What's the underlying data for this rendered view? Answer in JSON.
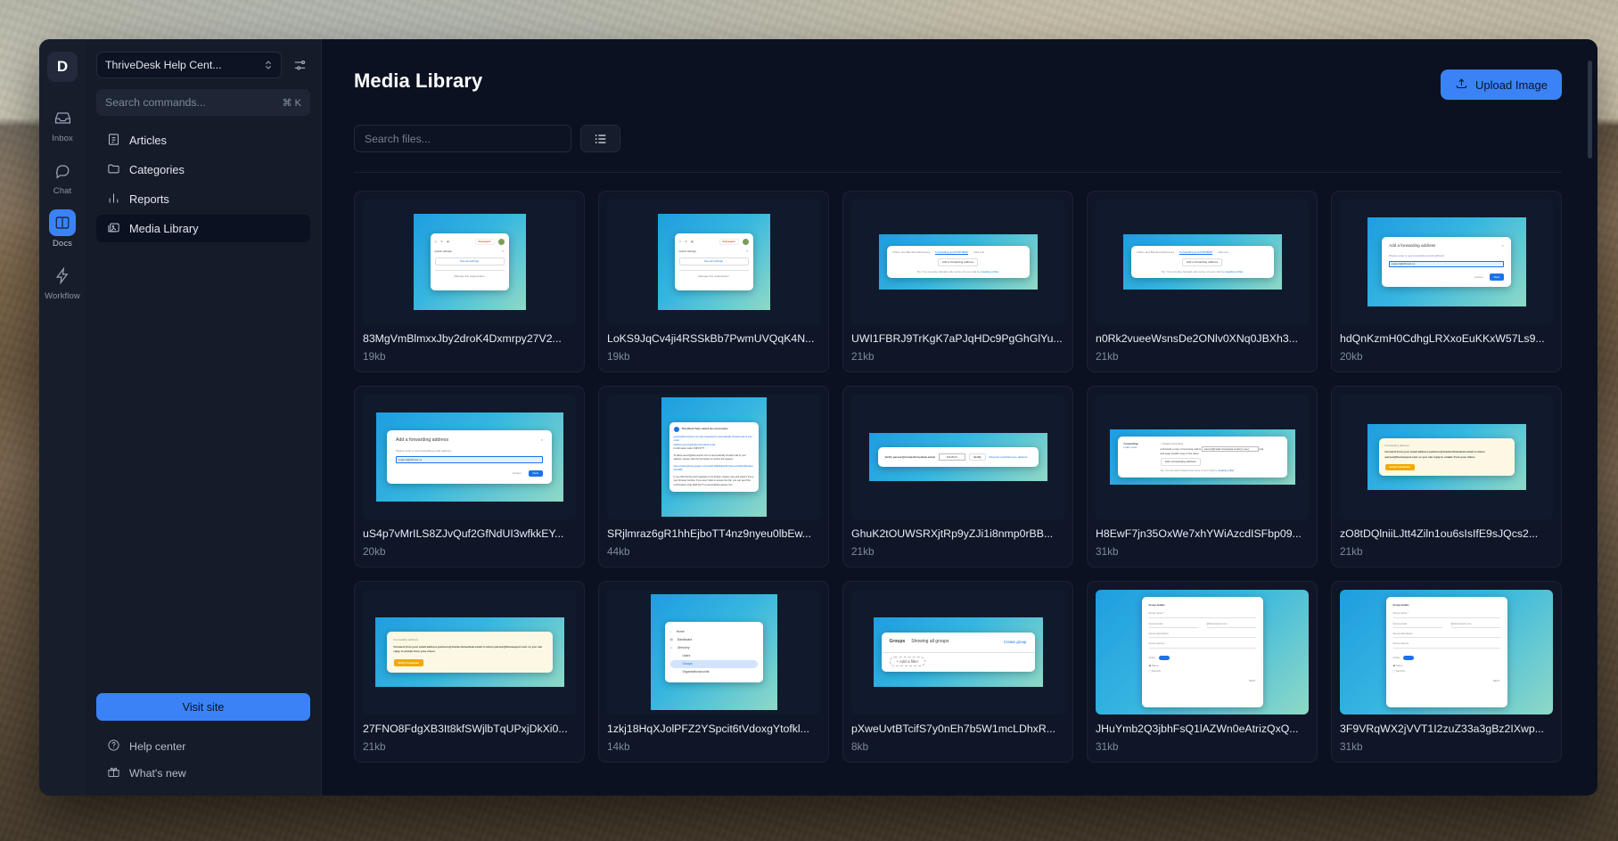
{
  "app": {
    "logo_letter": "D"
  },
  "rail": {
    "items": [
      {
        "label": "Inbox",
        "icon": "inbox-icon",
        "active": false
      },
      {
        "label": "Chat",
        "icon": "chat-bubble-icon",
        "active": false
      },
      {
        "label": "Docs",
        "icon": "book-icon",
        "active": true
      },
      {
        "label": "Workflow",
        "icon": "lightning-icon",
        "active": false
      }
    ]
  },
  "sidebar": {
    "workspace": "ThriveDesk Help Cent...",
    "workspace_icon": "chevron-updown-icon",
    "filter_icon": "sliders-icon",
    "command_search": {
      "placeholder": "Search commands...",
      "shortcut": "⌘ K"
    },
    "nav": [
      {
        "label": "Articles",
        "icon": "article-icon",
        "active": false
      },
      {
        "label": "Categories",
        "icon": "folder-icon",
        "active": false
      },
      {
        "label": "Reports",
        "icon": "bar-chart-icon",
        "active": false
      },
      {
        "label": "Media Library",
        "icon": "image-icon",
        "active": true
      }
    ],
    "visit_site": "Visit site",
    "footer": [
      {
        "label": "Help center",
        "icon": "question-circle-icon"
      },
      {
        "label": "What's new",
        "icon": "gift-icon"
      }
    ]
  },
  "main": {
    "title": "Media Library",
    "upload_button": {
      "label": "Upload Image",
      "icon": "upload-icon"
    },
    "file_search_placeholder": "Search files...",
    "view_toggle_icon": "list-view-icon",
    "files": [
      {
        "name": "83MgVmBlmxxJby2droK4Dxmrpy27V2...",
        "size": "19kb",
        "mock": "quick-settings"
      },
      {
        "name": "LoKS9JqCv4ji4RSSkBb7PwmUVQqK4N...",
        "size": "19kb",
        "mock": "quick-settings"
      },
      {
        "name": "UWI1FBRJ9TrKgK7aPJqHDc9PgGhGlYu...",
        "size": "21kb",
        "mock": "forwarding-tabs"
      },
      {
        "name": "n0Rk2vueeWsnsDe2ONlv0XNq0JBXh3...",
        "size": "21kb",
        "mock": "forwarding-tabs"
      },
      {
        "name": "hdQnKzmH0CdhgLRXxoEuKKxW57Ls9...",
        "size": "20kb",
        "mock": "add-forwarding-dialog"
      },
      {
        "name": "uS4p7vMrILS8ZJvQuf2GfNdUI3wfkkEY...",
        "size": "20kb",
        "mock": "add-forwarding-dialog"
      },
      {
        "name": "SRjlmraz6gR1hhEjboTT4nz9nyeu0lbEw...",
        "size": "44kb",
        "mock": "confirmation-email"
      },
      {
        "name": "GhuK2tOUWSRXjtRp9yZJi1i8nmp0rBB...",
        "size": "21kb",
        "mock": "verify-bar"
      },
      {
        "name": "H8EwF7jn35OxWe7xhYWiAzcdISFbp09...",
        "size": "31kb",
        "mock": "forwarding-settings"
      },
      {
        "name": "zO8tDQlniiLJtt4Ziln1ou6sIsIfE9sJQcs2...",
        "size": "21kb",
        "mock": "forwarding-banner"
      },
      {
        "name": "27FNO8FdgXB3It8kfSWjlbTqUPxjDkXi0...",
        "size": "21kb",
        "mock": "forwarding-banner"
      },
      {
        "name": "1zkj18HqXJolPFZ2YSpcit6tVdoxgYtofkl...",
        "size": "14kb",
        "mock": "admin-nav"
      },
      {
        "name": "pXweUvtBTcifS7y0nEh7b5W1mcLDhxR...",
        "size": "8kb",
        "mock": "groups-panel"
      },
      {
        "name": "JHuYmb2Q3jbhFsQ1lAZWn0eAtrizQxQ...",
        "size": "31kb",
        "mock": "group-form"
      },
      {
        "name": "3F9VRqWX2jVVT1I2zuZ33a3gBz2IXwp...",
        "size": "31kb",
        "mock": "group-form"
      }
    ]
  },
  "thumbnails": {
    "quick_settings": {
      "title": "Quick settings",
      "close": "✕",
      "link": "See all settings",
      "footer": "Manage this organization",
      "brand": "themespert"
    },
    "forwarding_tabs": {
      "tabs": [
        "Filters and Blocked Addresses",
        "Forwarding and POP/IMAP",
        "Add-ons"
      ],
      "button": "Add a forwarding address",
      "tip": "Tip: You can also forward only some of your mail by",
      "tip_link": "creating a filter"
    },
    "add_forwarding_dialog": {
      "title": "Add a forwarding address",
      "close": "✕",
      "label": "Please enter a new forwarding email address:",
      "value": "support@thrived.co",
      "cancel": "Cancel",
      "next": "Next"
    },
    "confirmation_email": {
      "subject": "ThriveDesk Team started the conversation",
      "line1": "parvez@themespert.com has requested to automatically forward mail to your email",
      "line2": "address parvez@inside.thrivedesk.email",
      "code": "Confirmation code: 1583 5777",
      "para": "To allow parvez@themespert.com to automatically forward mail to your address, please click the link below to confirm the request:",
      "link": "https://mail-settings.google.com/mail/vf-b9kb9dpkA9c7dwa-wU1q5cVI5ecEuaWoX080",
      "tail": "If you click the link and it appears to be broken, please copy and paste it into a new browser window. If you aren't able to access the link, you can send the confirmation code 4645 9177 to parvez@themespert.com."
    },
    "verify_bar": {
      "text": "Verify parvez@inside.thrivedesk.email",
      "code": "15415171",
      "button": "Verify",
      "links": "Resend email  Remove address"
    },
    "forwarding_settings": {
      "label": "Forwarding:",
      "learn": "Learn more",
      "opt1": "Disable forwarding",
      "opt2": "Forward a copy of incoming mail to",
      "select": "parvez@inside.thrivedesk.email (in use)",
      "keep": "and keep Gmail's copy in the Inbox",
      "button": "Add a forwarding address",
      "tip": "Tip: You can also forward only some of your mail by",
      "tip_link": "creating a filter"
    },
    "forwarding_banner": {
      "title": "Forwarding address",
      "body": "Forward from your email address partners@inside.thrivedesk.email to inbox parvez@themespert.com so you can reply to emails from your inbox.",
      "button": "Verify Forwarder"
    },
    "admin_nav": {
      "items": [
        "Home",
        "Dashboard",
        "Directory",
        "Users",
        "Groups",
        "Organizational units"
      ],
      "active": "Groups"
    },
    "groups_panel": {
      "title": "Groups",
      "subtitle": "Showing all groups",
      "action": "Create group",
      "filter": "Add a filter"
    },
    "group_form": {
      "heading": "Group details",
      "fields": [
        "Group name *",
        "Group email",
        "Group description",
        "Group owners"
      ],
      "domain": "@themespert.com",
      "toggle": "Active",
      "opt1": "Name",
      "opt2": "Security",
      "submit": "NEXT"
    }
  },
  "colors": {
    "accent": "#3b82f6",
    "panel": "#0b1120",
    "sidebar": "#151b29",
    "rail": "#171d2b",
    "card": "#0f1627"
  }
}
